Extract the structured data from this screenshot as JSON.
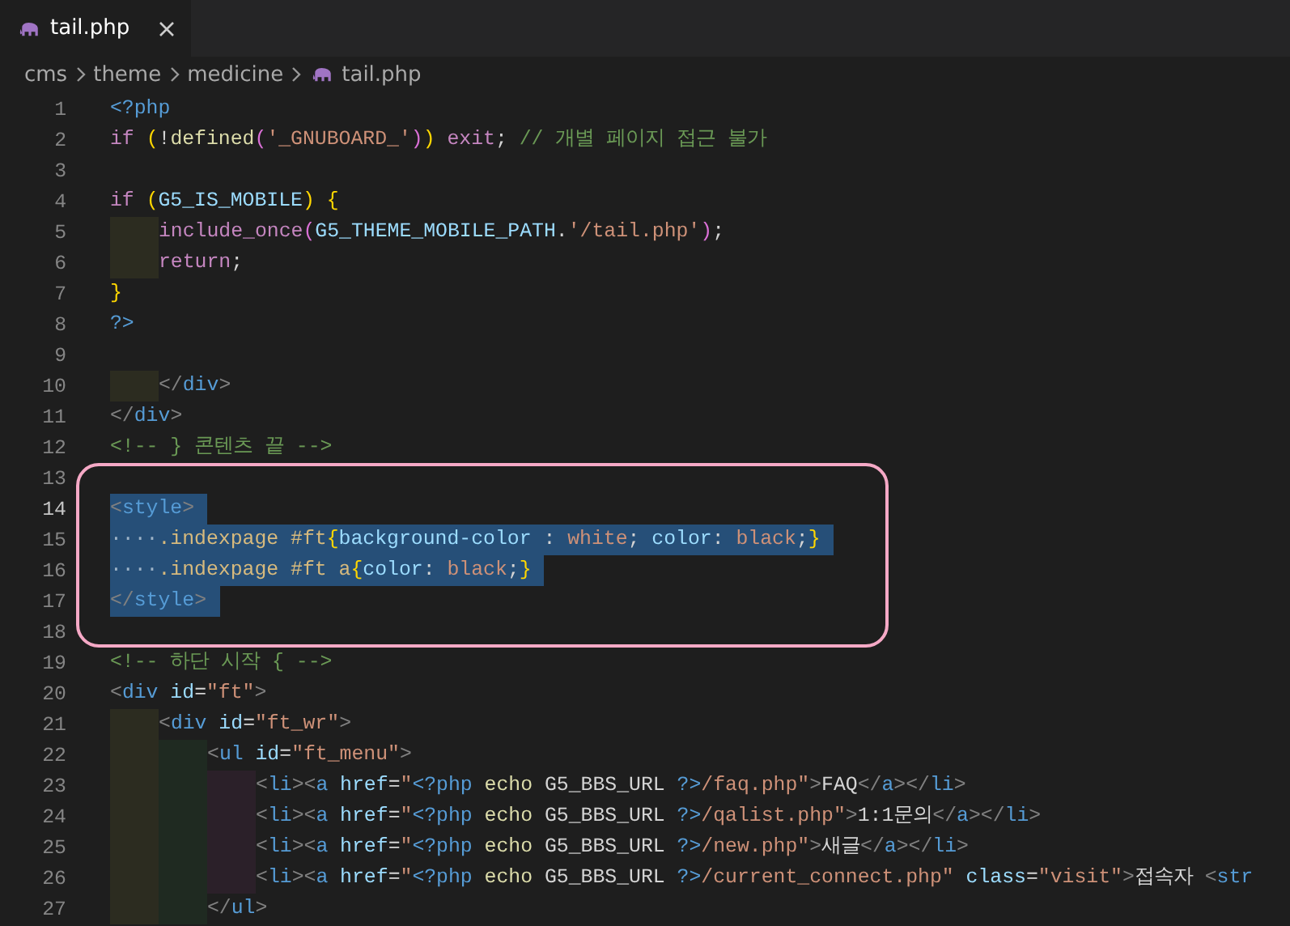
{
  "tabs": [
    {
      "label": "tail.php",
      "selected": true
    }
  ],
  "breadcrumb": [
    "cms",
    "theme",
    "medicine",
    "tail.php"
  ],
  "blocks": [
    {
      "circled": false,
      "lines": [
        {
          "number": "1",
          "selected": false,
          "current": false,
          "tokens": [
            {
              "kind": "php",
              "text": "<?php"
            }
          ]
        },
        {
          "number": "2",
          "selected": false,
          "current": false,
          "tokens": [
            {
              "kind": "kw",
              "text": "if "
            },
            {
              "kind": "b1",
              "text": "("
            },
            {
              "kind": "txt",
              "text": "!"
            },
            {
              "kind": "fn",
              "text": "defined"
            },
            {
              "kind": "b2",
              "text": "("
            },
            {
              "kind": "str",
              "text": "'_GNUBOARD_'"
            },
            {
              "kind": "b2",
              "text": ")"
            },
            {
              "kind": "b1",
              "text": ")"
            },
            {
              "kind": "kw",
              "text": " exit"
            },
            {
              "kind": "txt",
              "text": "; "
            },
            {
              "kind": "cmt",
              "text": "// 개별 페이지 접근 불가"
            }
          ]
        },
        {
          "number": "3",
          "current": false
        },
        {
          "number": "4",
          "selected": false,
          "current": false,
          "tokens": [
            {
              "kind": "kw",
              "text": "if "
            },
            {
              "kind": "b1",
              "text": "("
            },
            {
              "kind": "const",
              "text": "G5_IS_MOBILE"
            },
            {
              "kind": "b1",
              "text": ") {"
            }
          ]
        },
        {
          "number": "5",
          "selected": false,
          "current": false,
          "guides": [
            {
              "color": "#2c2c20"
            }
          ],
          "tokens": [
            {
              "kind": "kw",
              "text": "include_once"
            },
            {
              "kind": "b2",
              "text": "("
            },
            {
              "kind": "const",
              "text": "G5_THEME_MOBILE_PATH"
            },
            {
              "kind": "txt",
              "text": "."
            },
            {
              "kind": "str",
              "text": "'/tail.php'"
            },
            {
              "kind": "b2",
              "text": ")"
            },
            {
              "kind": "txt",
              "text": ";"
            }
          ]
        },
        {
          "number": "6",
          "selected": false,
          "current": false,
          "guides": [
            {
              "color": "#2c2c20"
            }
          ],
          "tokens": [
            {
              "kind": "kw",
              "text": "return"
            },
            {
              "kind": "txt",
              "text": ";"
            }
          ]
        },
        {
          "number": "7",
          "selected": false,
          "current": false,
          "tokens": [
            {
              "kind": "b1",
              "text": "}"
            }
          ]
        },
        {
          "number": "8",
          "selected": false,
          "current": false,
          "tokens": [
            {
              "kind": "php",
              "text": "?>"
            }
          ]
        },
        {
          "number": "9",
          "current": false
        },
        {
          "number": "10",
          "selected": false,
          "current": false,
          "guides": [
            {
              "color": "#2c2c20"
            }
          ],
          "tokens": [
            {
              "kind": "p",
              "text": "</"
            },
            {
              "kind": "tag",
              "text": "div"
            },
            {
              "kind": "p",
              "text": ">"
            }
          ]
        },
        {
          "number": "11",
          "selected": false,
          "current": false,
          "tokens": [
            {
              "kind": "p",
              "text": "</"
            },
            {
              "kind": "tag",
              "text": "div"
            },
            {
              "kind": "p",
              "text": ">"
            }
          ]
        },
        {
          "number": "12",
          "selected": false,
          "current": false,
          "tokens": [
            {
              "kind": "cmt",
              "text": "<!-- } 콘텐츠 끝 -->"
            }
          ]
        }
      ]
    },
    {
      "circled": true,
      "lines": [
        {
          "number": "13",
          "current": false
        },
        {
          "number": "14",
          "selected": true,
          "current": true,
          "tokens": [
            {
              "kind": "p",
              "text": "<"
            },
            {
              "kind": "tag",
              "text": "style"
            },
            {
              "kind": "p",
              "text": ">"
            }
          ]
        },
        {
          "number": "15",
          "selected": true,
          "current": false,
          "tokens": [
            {
              "kind": "ws",
              "text": "····"
            },
            {
              "kind": "sel",
              "text": ".indexpage #ft"
            },
            {
              "kind": "b1",
              "text": "{"
            },
            {
              "kind": "prop",
              "text": "background-color"
            },
            {
              "kind": "txt",
              "text": " : "
            },
            {
              "kind": "val",
              "text": "white"
            },
            {
              "kind": "txt",
              "text": "; "
            },
            {
              "kind": "prop",
              "text": "color"
            },
            {
              "kind": "txt",
              "text": ": "
            },
            {
              "kind": "val",
              "text": "black"
            },
            {
              "kind": "txt",
              "text": ";"
            },
            {
              "kind": "b1",
              "text": "}"
            }
          ]
        },
        {
          "number": "16",
          "selected": true,
          "current": false,
          "tokens": [
            {
              "kind": "ws",
              "text": "····"
            },
            {
              "kind": "sel",
              "text": ".indexpage #ft a"
            },
            {
              "kind": "b1",
              "text": "{"
            },
            {
              "kind": "prop",
              "text": "color"
            },
            {
              "kind": "txt",
              "text": ": "
            },
            {
              "kind": "val",
              "text": "black"
            },
            {
              "kind": "txt",
              "text": ";"
            },
            {
              "kind": "b1",
              "text": "}"
            }
          ]
        },
        {
          "number": "17",
          "selected": true,
          "current": false,
          "tokens": [
            {
              "kind": "p",
              "text": "</"
            },
            {
              "kind": "tag",
              "text": "style"
            },
            {
              "kind": "p",
              "text": ">"
            }
          ]
        },
        {
          "number": "18",
          "current": false
        }
      ]
    },
    {
      "circled": false,
      "lines": [
        {
          "number": "19",
          "selected": false,
          "current": false,
          "tokens": [
            {
              "kind": "cmt",
              "text": "<!-- 하단 시작 { -->"
            }
          ]
        },
        {
          "number": "20",
          "selected": false,
          "current": false,
          "tokens": [
            {
              "kind": "p",
              "text": "<"
            },
            {
              "kind": "tag",
              "text": "div"
            },
            {
              "kind": "attr",
              "text": " id"
            },
            {
              "kind": "txt",
              "text": "="
            },
            {
              "kind": "str",
              "text": "\"ft\""
            },
            {
              "kind": "p",
              "text": ">"
            }
          ]
        },
        {
          "number": "21",
          "selected": false,
          "current": false,
          "guides": [
            {
              "color": "#2c2c20"
            }
          ],
          "tokens": [
            {
              "kind": "p",
              "text": "<"
            },
            {
              "kind": "tag",
              "text": "div"
            },
            {
              "kind": "attr",
              "text": " id"
            },
            {
              "kind": "txt",
              "text": "="
            },
            {
              "kind": "str",
              "text": "\"ft_wr\""
            },
            {
              "kind": "p",
              "text": ">"
            }
          ]
        },
        {
          "number": "22",
          "selected": false,
          "current": false,
          "guides": [
            {
              "color": "#2c2c20"
            },
            {
              "color": "#1f2a21"
            }
          ],
          "tokens": [
            {
              "kind": "p",
              "text": "<"
            },
            {
              "kind": "tag",
              "text": "ul"
            },
            {
              "kind": "attr",
              "text": " id"
            },
            {
              "kind": "txt",
              "text": "="
            },
            {
              "kind": "str",
              "text": "\"ft_menu\""
            },
            {
              "kind": "p",
              "text": ">"
            }
          ]
        },
        {
          "number": "23",
          "selected": false,
          "current": false,
          "guides": [
            {
              "color": "#2c2c20"
            },
            {
              "color": "#1f2a21"
            },
            {
              "color": "#2b2029"
            }
          ],
          "tokens": [
            {
              "kind": "p",
              "text": "<"
            },
            {
              "kind": "tag",
              "text": "li"
            },
            {
              "kind": "p",
              "text": "><"
            },
            {
              "kind": "tag",
              "text": "a"
            },
            {
              "kind": "attr",
              "text": " href"
            },
            {
              "kind": "txt",
              "text": "="
            },
            {
              "kind": "str",
              "text": "\""
            },
            {
              "kind": "php",
              "text": "<?php"
            },
            {
              "kind": "fn",
              "text": " echo"
            },
            {
              "kind": "txt",
              "text": " G5_BBS_URL "
            },
            {
              "kind": "php",
              "text": "?>"
            },
            {
              "kind": "str",
              "text": "/faq.php\""
            },
            {
              "kind": "p",
              "text": ">"
            },
            {
              "kind": "txt",
              "text": "FAQ"
            },
            {
              "kind": "p",
              "text": "</"
            },
            {
              "kind": "tag",
              "text": "a"
            },
            {
              "kind": "p",
              "text": "></"
            },
            {
              "kind": "tag",
              "text": "li"
            },
            {
              "kind": "p",
              "text": ">"
            }
          ]
        },
        {
          "number": "24",
          "selected": false,
          "current": false,
          "guides": [
            {
              "color": "#2c2c20"
            },
            {
              "color": "#1f2a21"
            },
            {
              "color": "#2b2029"
            }
          ],
          "tokens": [
            {
              "kind": "p",
              "text": "<"
            },
            {
              "kind": "tag",
              "text": "li"
            },
            {
              "kind": "p",
              "text": "><"
            },
            {
              "kind": "tag",
              "text": "a"
            },
            {
              "kind": "attr",
              "text": " href"
            },
            {
              "kind": "txt",
              "text": "="
            },
            {
              "kind": "str",
              "text": "\""
            },
            {
              "kind": "php",
              "text": "<?php"
            },
            {
              "kind": "fn",
              "text": " echo"
            },
            {
              "kind": "txt",
              "text": " G5_BBS_URL "
            },
            {
              "kind": "php",
              "text": "?>"
            },
            {
              "kind": "str",
              "text": "/qalist.php\""
            },
            {
              "kind": "p",
              "text": ">"
            },
            {
              "kind": "txt",
              "text": "1:1문의"
            },
            {
              "kind": "p",
              "text": "</"
            },
            {
              "kind": "tag",
              "text": "a"
            },
            {
              "kind": "p",
              "text": "></"
            },
            {
              "kind": "tag",
              "text": "li"
            },
            {
              "kind": "p",
              "text": ">"
            }
          ]
        },
        {
          "number": "25",
          "selected": false,
          "current": false,
          "guides": [
            {
              "color": "#2c2c20"
            },
            {
              "color": "#1f2a21"
            },
            {
              "color": "#2b2029"
            }
          ],
          "tokens": [
            {
              "kind": "p",
              "text": "<"
            },
            {
              "kind": "tag",
              "text": "li"
            },
            {
              "kind": "p",
              "text": "><"
            },
            {
              "kind": "tag",
              "text": "a"
            },
            {
              "kind": "attr",
              "text": " href"
            },
            {
              "kind": "txt",
              "text": "="
            },
            {
              "kind": "str",
              "text": "\""
            },
            {
              "kind": "php",
              "text": "<?php"
            },
            {
              "kind": "fn",
              "text": " echo"
            },
            {
              "kind": "txt",
              "text": " G5_BBS_URL "
            },
            {
              "kind": "php",
              "text": "?>"
            },
            {
              "kind": "str",
              "text": "/new.php\""
            },
            {
              "kind": "p",
              "text": ">"
            },
            {
              "kind": "txt",
              "text": "새글"
            },
            {
              "kind": "p",
              "text": "</"
            },
            {
              "kind": "tag",
              "text": "a"
            },
            {
              "kind": "p",
              "text": "></"
            },
            {
              "kind": "tag",
              "text": "li"
            },
            {
              "kind": "p",
              "text": ">"
            }
          ]
        },
        {
          "number": "26",
          "selected": false,
          "current": false,
          "guides": [
            {
              "color": "#2c2c20"
            },
            {
              "color": "#1f2a21"
            },
            {
              "color": "#2b2029"
            }
          ],
          "tokens": [
            {
              "kind": "p",
              "text": "<"
            },
            {
              "kind": "tag",
              "text": "li"
            },
            {
              "kind": "p",
              "text": "><"
            },
            {
              "kind": "tag",
              "text": "a"
            },
            {
              "kind": "attr",
              "text": " href"
            },
            {
              "kind": "txt",
              "text": "="
            },
            {
              "kind": "str",
              "text": "\""
            },
            {
              "kind": "php",
              "text": "<?php"
            },
            {
              "kind": "fn",
              "text": " echo"
            },
            {
              "kind": "txt",
              "text": " G5_BBS_URL "
            },
            {
              "kind": "php",
              "text": "?>"
            },
            {
              "kind": "str",
              "text": "/current_connect.php\""
            },
            {
              "kind": "attr",
              "text": " class"
            },
            {
              "kind": "txt",
              "text": "="
            },
            {
              "kind": "str",
              "text": "\"visit\""
            },
            {
              "kind": "p",
              "text": ">"
            },
            {
              "kind": "txt",
              "text": "접속자 "
            },
            {
              "kind": "p",
              "text": "<"
            },
            {
              "kind": "tag",
              "text": "str"
            }
          ]
        },
        {
          "number": "27",
          "selected": false,
          "current": false,
          "guides": [
            {
              "color": "#2c2c20"
            },
            {
              "color": "#1f2a21"
            }
          ],
          "tokens": [
            {
              "kind": "p",
              "text": "</"
            },
            {
              "kind": "tag",
              "text": "ul"
            },
            {
              "kind": "p",
              "text": ">"
            }
          ]
        }
      ]
    }
  ]
}
